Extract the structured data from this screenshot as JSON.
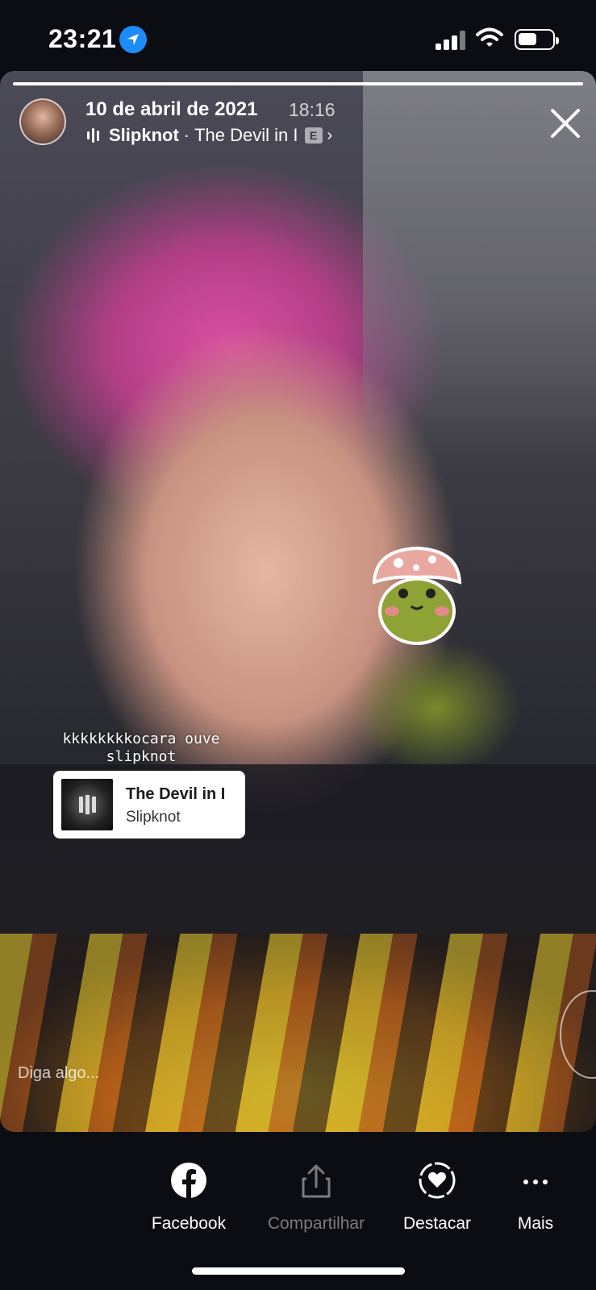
{
  "status_bar": {
    "time": "23:21",
    "icons": [
      "location-arrow-icon",
      "cellular-signal-icon",
      "wifi-icon",
      "battery-icon"
    ],
    "battery_level": 0.55,
    "accent": "#1d8cf8"
  },
  "story": {
    "progress": 1.0,
    "date": "10 de abril de 2021",
    "time": "18:16",
    "music": {
      "artist": "Slipknot",
      "separator": "·",
      "song": "The Devil in I",
      "explicit": "E",
      "chevron": "›"
    },
    "sticker": {
      "caption": "kkkkkkkkocara ouve slipknot",
      "song_title": "The Devil in I",
      "artist": "Slipknot"
    },
    "reply_placeholder": "Diga algo..."
  },
  "actions": [
    {
      "label": "Facebook",
      "icon": "facebook-icon",
      "enabled": true
    },
    {
      "label": "Compartilhar",
      "icon": "share-icon",
      "enabled": false
    },
    {
      "label": "Destacar",
      "icon": "highlight-heart-icon",
      "enabled": true
    },
    {
      "label": "Mais",
      "icon": "more-icon",
      "enabled": true
    }
  ]
}
